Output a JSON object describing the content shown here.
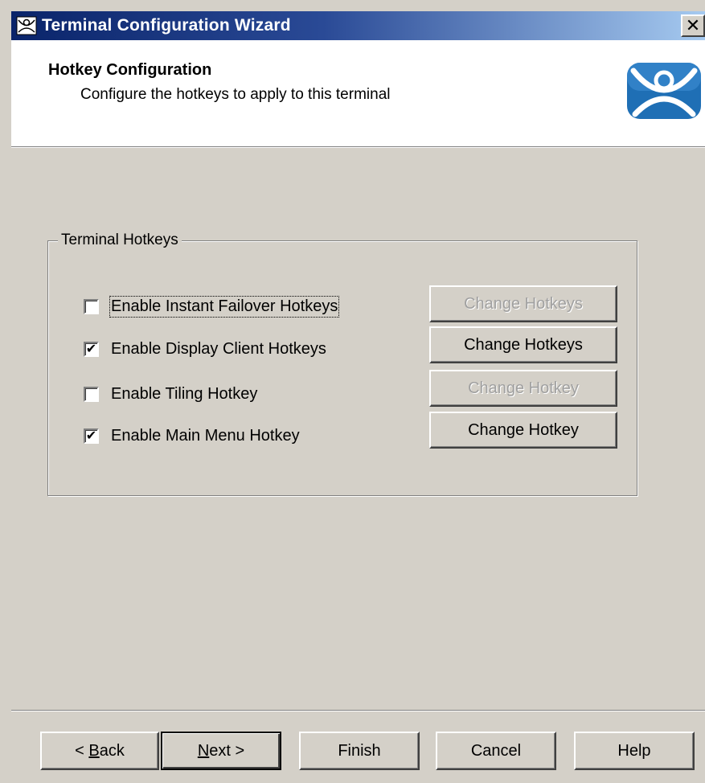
{
  "window": {
    "title": "Terminal Configuration Wizard",
    "icon": "thinmanager-icon",
    "close_label": "✕"
  },
  "header": {
    "title": "Hotkey Configuration",
    "subtitle": "Configure the hotkeys to apply to this terminal",
    "logo": "thinmanager-logo",
    "logo_color": "#1f6fb5"
  },
  "group": {
    "legend": "Terminal Hotkeys",
    "rows": [
      {
        "label": "Enable Instant Failover Hotkeys",
        "checked": false,
        "checkmark": "",
        "button_label": "Change Hotkeys",
        "button_enabled": false
      },
      {
        "label": "Enable Display Client Hotkeys",
        "checked": true,
        "checkmark": "✔",
        "button_label": "Change Hotkeys",
        "button_enabled": true
      },
      {
        "label": "Enable Tiling Hotkey",
        "checked": false,
        "checkmark": "",
        "button_label": "Change Hotkey",
        "button_enabled": false
      },
      {
        "label": "Enable Main Menu Hotkey",
        "checked": true,
        "checkmark": "✔",
        "button_label": "Change Hotkey",
        "button_enabled": true
      }
    ]
  },
  "footer": {
    "back_prefix": "< ",
    "back_mnemonic": "B",
    "back_rest": "ack",
    "next_mnemonic": "N",
    "next_rest": "ext >",
    "finish": "Finish",
    "cancel": "Cancel",
    "help": "Help"
  }
}
